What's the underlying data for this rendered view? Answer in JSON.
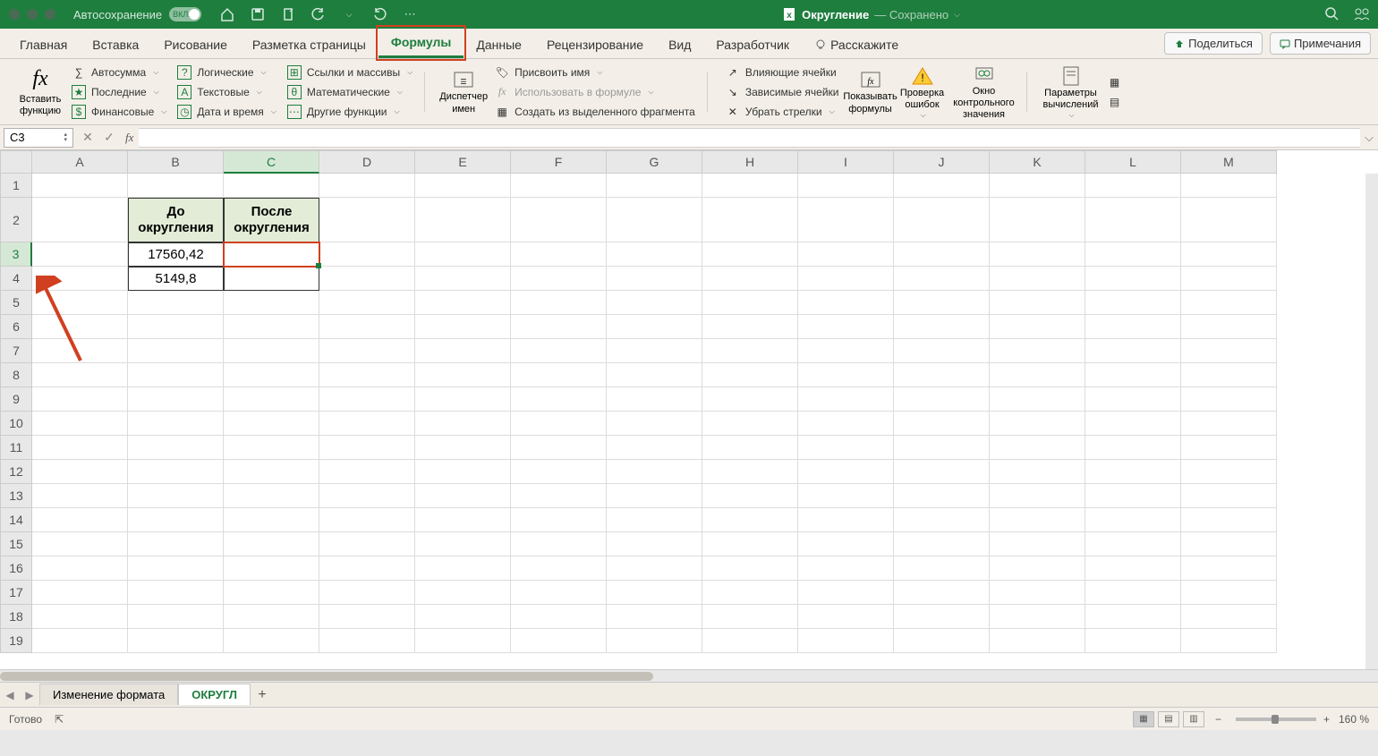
{
  "titlebar": {
    "autosave_label": "Автосохранение",
    "autosave_toggle": "ВКЛ.",
    "filename": "Округление",
    "saved_status": "— Сохранено"
  },
  "tabs": {
    "items": [
      "Главная",
      "Вставка",
      "Рисование",
      "Разметка страницы",
      "Формулы",
      "Данные",
      "Рецензирование",
      "Вид",
      "Разработчик"
    ],
    "active_index": 4,
    "tell_me": "Расскажите",
    "share": "Поделиться",
    "comments": "Примечания"
  },
  "ribbon": {
    "insert_fn": "Вставить функцию",
    "autosum": "Автосумма",
    "recent": "Последние",
    "financial": "Финансовые",
    "logical": "Логические",
    "text": "Текстовые",
    "datetime": "Дата и время",
    "lookup": "Ссылки и массивы",
    "math": "Математические",
    "more": "Другие функции",
    "name_mgr": "Диспетчер имен",
    "define_name": "Присвоить имя",
    "use_formula": "Использовать в формуле",
    "create_sel": "Создать из выделенного фрагмента",
    "trace_prec": "Влияющие ячейки",
    "trace_dep": "Зависимые ячейки",
    "remove_arrows": "Убрать стрелки",
    "show_formulas": "Показывать формулы",
    "error_check": "Проверка ошибок",
    "watch": "Окно контрольного значения",
    "calc_opts": "Параметры вычислений"
  },
  "formula_bar": {
    "name_box": "C3"
  },
  "grid": {
    "columns": [
      "A",
      "B",
      "C",
      "D",
      "E",
      "F",
      "G",
      "H",
      "I",
      "J",
      "K",
      "L",
      "M"
    ],
    "rows": [
      1,
      2,
      3,
      4,
      5,
      6,
      7,
      8,
      9,
      10,
      11,
      12,
      13,
      14,
      15,
      16,
      17,
      18,
      19
    ],
    "header_b": "До округления",
    "header_c": "После округления",
    "b3": "17560,42",
    "b4": "5149,8",
    "selected": "C3"
  },
  "sheets": {
    "nav_prev": "◀",
    "nav_next": "▶",
    "tabs": [
      "Изменение формата",
      "ОКРУГЛ"
    ],
    "active_index": 1
  },
  "status": {
    "ready": "Готово",
    "zoom": "160 %"
  }
}
